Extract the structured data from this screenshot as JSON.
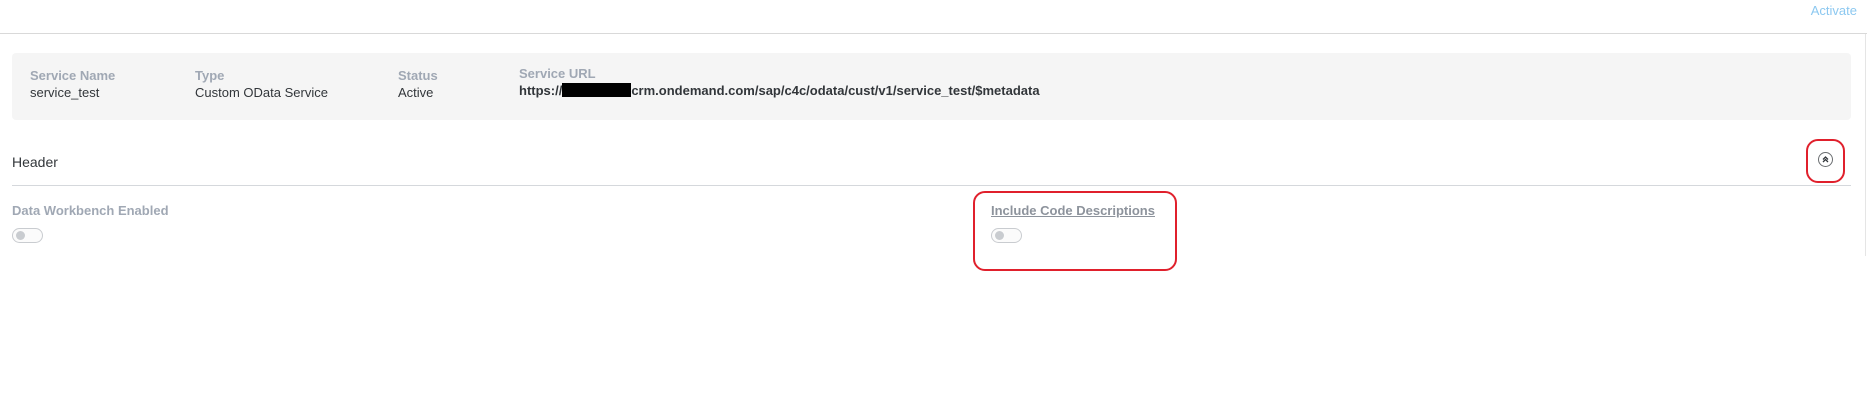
{
  "toolbar": {
    "activate_label": "Activate"
  },
  "service_info": {
    "name_label": "Service Name",
    "name_value": "service_test",
    "type_label": "Type",
    "type_value": "Custom OData Service",
    "status_label": "Status",
    "status_value": "Active",
    "url_label": "Service URL",
    "url_prefix": "https://",
    "url_suffix": "crm.ondemand.com/sap/c4c/odata/cust/v1/service_test/$metadata"
  },
  "header_section": {
    "title": "Header",
    "collapse_icon": "chevron-up-circle-icon",
    "fields": [
      {
        "label": "Data Workbench Enabled",
        "value": false
      },
      {
        "label": "Include Code Descriptions",
        "value": false
      }
    ]
  },
  "colors": {
    "accent_highlight": "#e0202c",
    "activate_text": "#8cc8f0",
    "panel_bg": "#f5f5f5",
    "label_text": "#a0a8b4"
  }
}
